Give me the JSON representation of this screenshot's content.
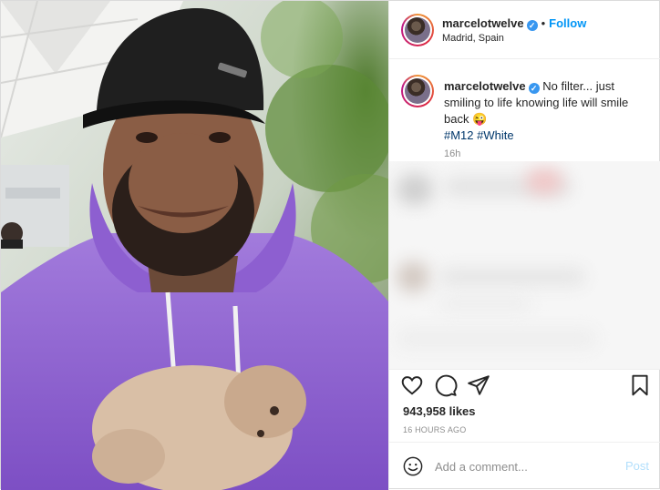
{
  "post": {
    "username": "marcelotwelve",
    "verified_mark": "✓",
    "separator": "•",
    "follow_label": "Follow",
    "location": "Madrid, Spain"
  },
  "caption": {
    "username": "marcelotwelve",
    "text": "No filter... just smiling to life knowing life will smile back",
    "emoji": "😜",
    "hashtags": [
      "#M12",
      "#White"
    ],
    "time_ago": "16h"
  },
  "actions": {
    "icons": [
      "heart-icon",
      "comment-icon",
      "share-icon",
      "bookmark-icon"
    ],
    "likes": "943,958 likes",
    "posted": "16 HOURS AGO"
  },
  "comment": {
    "placeholder": "Add a comment...",
    "post_label": "Post"
  },
  "colors": {
    "accent": "#0095f6",
    "hashtag": "#00376b",
    "muted": "#8e8e8e",
    "post_disabled": "#b2dffc",
    "hoodie": "#9b6fd6"
  }
}
